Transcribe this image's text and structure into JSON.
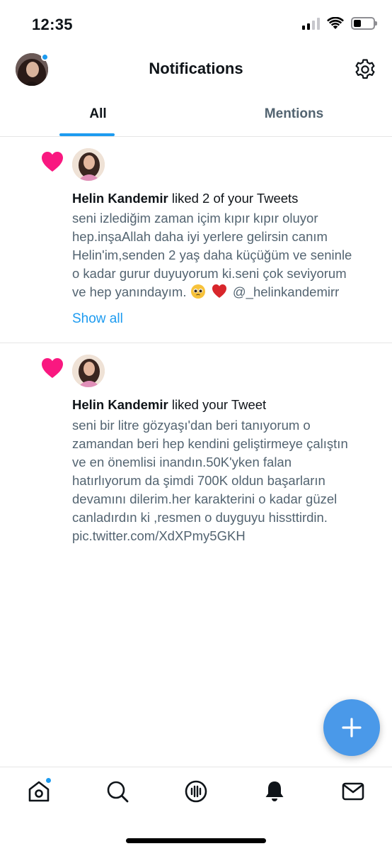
{
  "status_bar": {
    "time": "12:35"
  },
  "header": {
    "title": "Notifications"
  },
  "tabs": [
    {
      "label": "All",
      "active": true
    },
    {
      "label": "Mentions",
      "active": false
    }
  ],
  "notifications": [
    {
      "user": "Helin Kandemir",
      "action": "liked 2 of your Tweets",
      "lines": [
        "seni izlediğim zaman içim kıpır kıpır oluyor",
        "hep.inşaAllah daha iyi yerlere gelirsin canım",
        "Helin'im,senden 2 yaş daha küçüğüm ve seninle",
        "o kadar gurur duyuyorum ki.seni çok seviyorum",
        "ve hep yanındayım.",
        "@_helinkandemirr"
      ],
      "show_all": "Show all"
    },
    {
      "user": "Helin Kandemir",
      "action": "liked your Tweet",
      "lines": [
        "seni bir litre gözyaşı'dan beri tanıyorum o",
        "zamandan beri hep kendini geliştirmeye çalıştın",
        "ve en önemlisi inandın.50K'yken falan",
        "hatırlıyorum da şimdi 700K oldun başarların",
        "devamını dilerim.her karakterini o kadar güzel",
        "canladırdın ki ,resmen o duyguyu hissttirdin.",
        "pic.twitter.com/XdXPmy5GKH"
      ]
    }
  ],
  "colors": {
    "accent": "#1d9bf0",
    "like": "#f91880",
    "secondary_text": "#536471"
  },
  "icons": {
    "nav": [
      "home-icon",
      "search-icon",
      "spaces-icon",
      "notifications-bell-icon",
      "messages-icon"
    ],
    "fab": "compose-plus-icon"
  }
}
